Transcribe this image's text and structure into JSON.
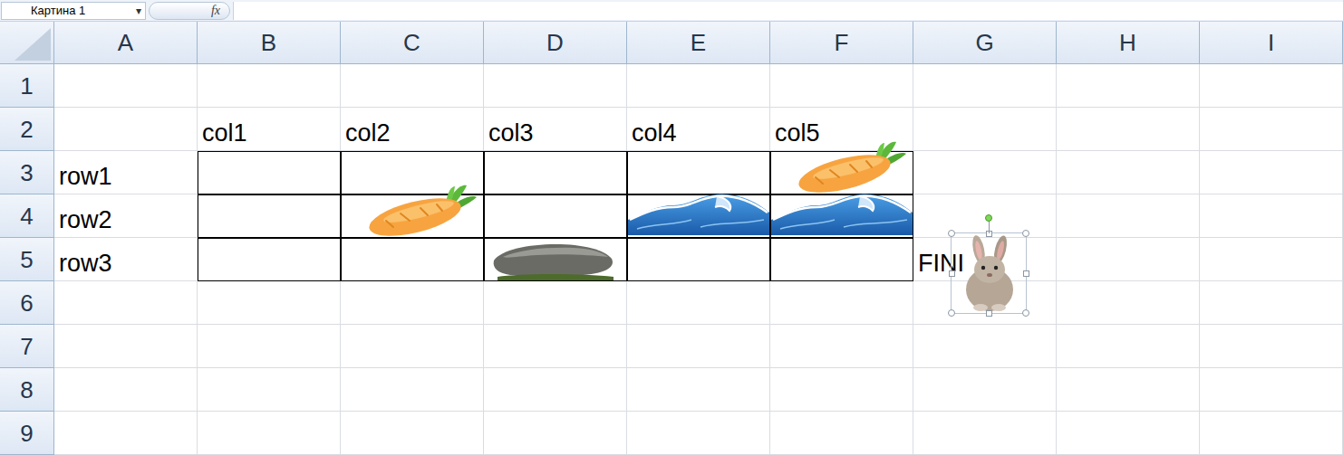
{
  "formula_bar": {
    "name_box": "Картина 1",
    "dropdown": "▾",
    "fx": "fx"
  },
  "columns": [
    "A",
    "B",
    "C",
    "D",
    "E",
    "F",
    "G",
    "H",
    "I"
  ],
  "rows": [
    {
      "header": "1",
      "cells": [
        {
          "text": "",
          "bordered": false
        },
        {
          "text": "",
          "bordered": false
        },
        {
          "text": "",
          "bordered": false
        },
        {
          "text": "",
          "bordered": false
        },
        {
          "text": "",
          "bordered": false
        },
        {
          "text": "",
          "bordered": false
        },
        {
          "text": "",
          "bordered": false
        },
        {
          "text": "",
          "bordered": false
        },
        {
          "text": "",
          "bordered": false
        }
      ]
    },
    {
      "header": "2",
      "cells": [
        {
          "text": "",
          "bordered": false
        },
        {
          "text": "col1",
          "bordered": false
        },
        {
          "text": "col2",
          "bordered": false
        },
        {
          "text": "col3",
          "bordered": false
        },
        {
          "text": "col4",
          "bordered": false
        },
        {
          "text": "col5",
          "bordered": false
        },
        {
          "text": "",
          "bordered": false
        },
        {
          "text": "",
          "bordered": false
        },
        {
          "text": "",
          "bordered": false
        }
      ]
    },
    {
      "header": "3",
      "cells": [
        {
          "text": "row1",
          "bordered": false
        },
        {
          "text": "",
          "bordered": true
        },
        {
          "text": "",
          "bordered": true
        },
        {
          "text": "",
          "bordered": true
        },
        {
          "text": "",
          "bordered": true
        },
        {
          "text": "",
          "bordered": true
        },
        {
          "text": "",
          "bordered": false
        },
        {
          "text": "",
          "bordered": false
        },
        {
          "text": "",
          "bordered": false
        }
      ]
    },
    {
      "header": "4",
      "cells": [
        {
          "text": "row2",
          "bordered": false
        },
        {
          "text": "",
          "bordered": true
        },
        {
          "text": "",
          "bordered": true
        },
        {
          "text": "",
          "bordered": true
        },
        {
          "text": "",
          "bordered": true
        },
        {
          "text": "",
          "bordered": true
        },
        {
          "text": "",
          "bordered": false
        },
        {
          "text": "",
          "bordered": false
        },
        {
          "text": "",
          "bordered": false
        }
      ]
    },
    {
      "header": "5",
      "cells": [
        {
          "text": "row3",
          "bordered": false
        },
        {
          "text": "",
          "bordered": true
        },
        {
          "text": "",
          "bordered": true
        },
        {
          "text": "",
          "bordered": true
        },
        {
          "text": "",
          "bordered": true
        },
        {
          "text": "",
          "bordered": true
        },
        {
          "text": "FINI",
          "bordered": false
        },
        {
          "text": "",
          "bordered": false
        },
        {
          "text": "",
          "bordered": false
        }
      ]
    },
    {
      "header": "6",
      "cells": [
        {
          "text": "",
          "bordered": false
        },
        {
          "text": "",
          "bordered": false
        },
        {
          "text": "",
          "bordered": false
        },
        {
          "text": "",
          "bordered": false
        },
        {
          "text": "",
          "bordered": false
        },
        {
          "text": "",
          "bordered": false
        },
        {
          "text": "",
          "bordered": false
        },
        {
          "text": "",
          "bordered": false
        },
        {
          "text": "",
          "bordered": false
        }
      ]
    },
    {
      "header": "7",
      "cells": [
        {
          "text": "",
          "bordered": false
        },
        {
          "text": "",
          "bordered": false
        },
        {
          "text": "",
          "bordered": false
        },
        {
          "text": "",
          "bordered": false
        },
        {
          "text": "",
          "bordered": false
        },
        {
          "text": "",
          "bordered": false
        },
        {
          "text": "",
          "bordered": false
        },
        {
          "text": "",
          "bordered": false
        },
        {
          "text": "",
          "bordered": false
        }
      ]
    },
    {
      "header": "8",
      "cells": [
        {
          "text": "",
          "bordered": false
        },
        {
          "text": "",
          "bordered": false
        },
        {
          "text": "",
          "bordered": false
        },
        {
          "text": "",
          "bordered": false
        },
        {
          "text": "",
          "bordered": false
        },
        {
          "text": "",
          "bordered": false
        },
        {
          "text": "",
          "bordered": false
        },
        {
          "text": "",
          "bordered": false
        },
        {
          "text": "",
          "bordered": false
        }
      ]
    },
    {
      "header": "9",
      "cells": [
        {
          "text": "",
          "bordered": false
        },
        {
          "text": "",
          "bordered": false
        },
        {
          "text": "",
          "bordered": false
        },
        {
          "text": "",
          "bordered": false
        },
        {
          "text": "",
          "bordered": false
        },
        {
          "text": "",
          "bordered": false
        },
        {
          "text": "",
          "bordered": false
        },
        {
          "text": "",
          "bordered": false
        },
        {
          "text": "",
          "bordered": false
        }
      ]
    }
  ],
  "pictures": [
    {
      "kind": "carrot",
      "cell": "C4",
      "selected": false
    },
    {
      "kind": "carrot",
      "cell": "F3",
      "selected": false
    },
    {
      "kind": "wave",
      "cell": "E4",
      "selected": false
    },
    {
      "kind": "wave",
      "cell": "F4",
      "selected": false
    },
    {
      "kind": "rock",
      "cell": "D5",
      "selected": false
    },
    {
      "kind": "rabbit",
      "cell": "G5",
      "selected": true
    }
  ]
}
